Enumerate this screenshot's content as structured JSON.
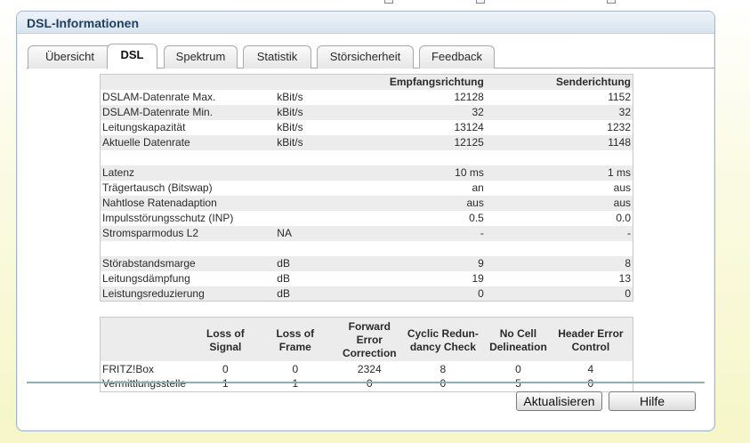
{
  "panel": {
    "title": "DSL-Informationen"
  },
  "tabs": [
    {
      "label": "Übersicht"
    },
    {
      "label": "DSL"
    },
    {
      "label": "Spektrum"
    },
    {
      "label": "Statistik"
    },
    {
      "label": "Störsicherheit"
    },
    {
      "label": "Feedback"
    }
  ],
  "dsl_table": {
    "header": {
      "col_down": "Empfangsrichtung",
      "col_up": "Senderichtung"
    },
    "rows": [
      {
        "label": "DSLAM-Datenrate Max.",
        "unit": "kBit/s",
        "down": "12128",
        "up": "1152"
      },
      {
        "label": "DSLAM-Datenrate Min.",
        "unit": "kBit/s",
        "down": "32",
        "up": "32"
      },
      {
        "label": "Leitungskapazität",
        "unit": "kBit/s",
        "down": "13124",
        "up": "1232"
      },
      {
        "label": "Aktuelle Datenrate",
        "unit": "kBit/s",
        "down": "12125",
        "up": "1148"
      },
      {
        "label": "Latenz",
        "unit": "",
        "down": "10 ms",
        "up": "1 ms"
      },
      {
        "label": "Trägertausch (Bitswap)",
        "unit": "",
        "down": "an",
        "up": "aus"
      },
      {
        "label": "Nahtlose Ratenadaption",
        "unit": "",
        "down": "aus",
        "up": "aus"
      },
      {
        "label": "Impulsstörungsschutz (INP)",
        "unit": "",
        "down": "0.5",
        "up": "0.0"
      },
      {
        "label": "Stromsparmodus L2",
        "unit": "NA",
        "down": "-",
        "up": "-"
      },
      {
        "label": "Störabstandsmarge",
        "unit": "dB",
        "down": "9",
        "up": "8"
      },
      {
        "label": "Leitungsdämpfung",
        "unit": "dB",
        "down": "19",
        "up": "13"
      },
      {
        "label": "Leistungsreduzierung",
        "unit": "dB",
        "down": "0",
        "up": "0"
      }
    ]
  },
  "error_table": {
    "headers": [
      {
        "l1": "Loss of",
        "l2": "Signal"
      },
      {
        "l1": "Loss of",
        "l2": "Frame"
      },
      {
        "l1": "Forward Error",
        "l2": "Correction"
      },
      {
        "l1": "Cyclic Redun-",
        "l2": "dancy Check"
      },
      {
        "l1": "No Cell",
        "l2": "Delineation"
      },
      {
        "l1": "Header Error",
        "l2": "Control"
      }
    ],
    "rows": [
      {
        "label": "FRITZ!Box",
        "values": [
          "0",
          "0",
          "2324",
          "8",
          "0",
          "4"
        ]
      },
      {
        "label": "Vermittlungsstelle",
        "values": [
          "1",
          "1",
          "0",
          "0",
          "5",
          "0"
        ]
      }
    ]
  },
  "buttons": {
    "refresh": "Aktualisieren",
    "help": "Hilfe"
  }
}
